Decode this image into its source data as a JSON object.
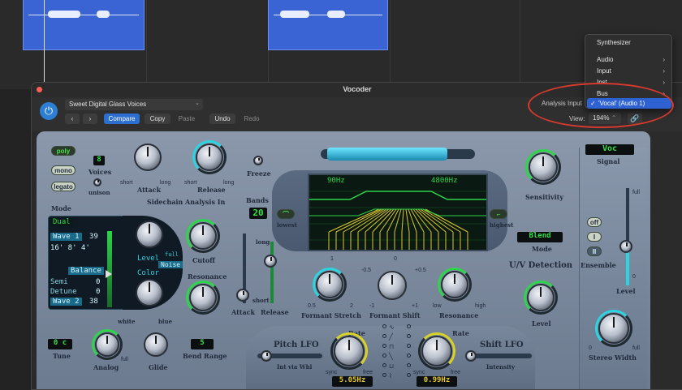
{
  "window": {
    "title": "Vocoder"
  },
  "header": {
    "preset": "Sweet Digital Glass Voices",
    "compare": "Compare",
    "copy": "Copy",
    "paste": "Paste",
    "undo": "Undo",
    "redo": "Redo",
    "analysis_input_label": "Analysis Input",
    "view_label": "View:",
    "view_value": "194%"
  },
  "menu": {
    "header": "Synthesizer",
    "items": [
      {
        "label": "Audio",
        "submenu": true
      },
      {
        "label": "Input",
        "submenu": true
      },
      {
        "label": "Inst",
        "submenu": true
      },
      {
        "label": "Bus",
        "submenu": true
      }
    ],
    "selected": "'Vocal' (Audio 1)"
  },
  "voices": {
    "poly": "poly",
    "mono": "mono",
    "legato": "legato",
    "voices_label": "Voices",
    "voices_value": "8",
    "unison": "unison"
  },
  "sidechain": {
    "title": "Sidechain Analysis In",
    "attack": "Attack",
    "release": "Release",
    "freeze": "Freeze",
    "short1": "short",
    "long1": "long",
    "short2": "short",
    "long2": "long",
    "bands_label": "Bands",
    "bands_value": "20"
  },
  "display": {
    "low_freq": "90Hz",
    "high_freq": "4800Hz",
    "lowest": "lowest",
    "highest": "highest"
  },
  "osc": {
    "mode_label": "Mode",
    "mode_value": "Dual",
    "wave1": "Wave 1",
    "wave1_value": "39",
    "footage": "16' 8' 4'",
    "balance": "Balance",
    "semi": "Semi",
    "semi_value": "0",
    "detune": "Detune",
    "detune_value": "0",
    "wave2": "Wave 2",
    "wave2_value": "38",
    "level": "Level",
    "full": "full",
    "noise": "Noise",
    "color": "Color",
    "white": "white",
    "blue": "blue"
  },
  "filter": {
    "cutoff": "Cutoff",
    "resonance": "Resonance",
    "attack": "Attack",
    "release": "Release",
    "long": "long",
    "short": "short"
  },
  "bottom": {
    "tune_value": "0 c",
    "tune": "Tune",
    "analog": "Analog",
    "full": "full",
    "glide": "Glide",
    "bend_value": "5",
    "bend_range": "Bend Range"
  },
  "formant": {
    "stretch": "Formant Stretch",
    "shift": "Formant Shift",
    "resonance": "Resonance",
    "stretch_min": "0.5",
    "stretch_max": "2",
    "stretch_top": "1",
    "shift_min": "-0.5",
    "shift_max": "+0.5",
    "shift_top": "0",
    "shift_low": "-1",
    "shift_high": "+1",
    "res_low": "low",
    "res_high": "high"
  },
  "lfo": {
    "pitch_title": "Pitch LFO",
    "pitch_sub": "Int via Whl",
    "rate": "Rate",
    "pitch_rate": "5.05Hz",
    "shift_title": "Shift LFO",
    "shift_sub": "Intensity",
    "shift_rate": "0.99Hz",
    "sync": "sync",
    "free": "free",
    "rate2": "Rate"
  },
  "right": {
    "signal_value": "Voc",
    "signal": "Signal",
    "sensitivity": "Sensitivity",
    "blend": "Blend",
    "mode": "Mode",
    "uv": "U/V Detection",
    "level": "Level",
    "off": "off",
    "i": "I",
    "ii": "II",
    "ensemble": "Ensemble",
    "level2": "Level",
    "stereo_width": "Stereo Width",
    "full": "full",
    "zero": "0"
  }
}
